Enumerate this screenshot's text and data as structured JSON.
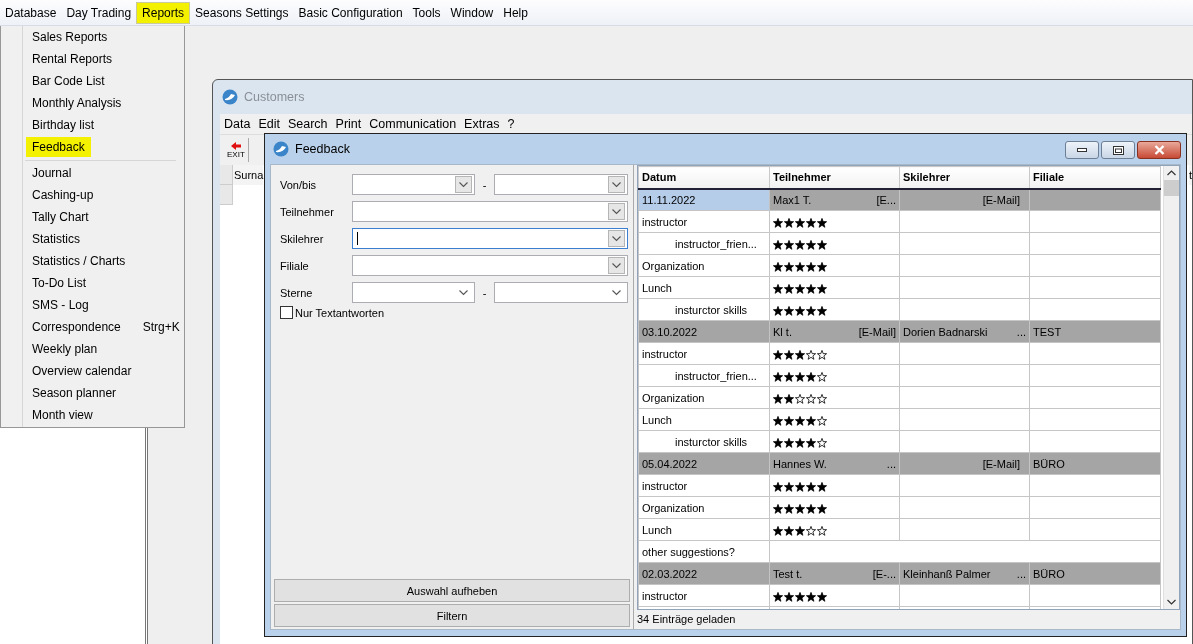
{
  "menubar": {
    "items": [
      {
        "label": "Database",
        "selected": false
      },
      {
        "label": "Day Trading",
        "selected": false
      },
      {
        "label": "Reports",
        "selected": true
      },
      {
        "label": "Seasons Settings",
        "selected": false
      },
      {
        "label": "Basic Configuration",
        "selected": false
      },
      {
        "label": "Tools",
        "selected": false
      },
      {
        "label": "Window",
        "selected": false
      },
      {
        "label": "Help",
        "selected": false
      }
    ]
  },
  "reports_menu": {
    "sections": [
      {
        "items": [
          {
            "label": "Sales Reports",
            "selected": false
          },
          {
            "label": "Rental Reports",
            "selected": false
          },
          {
            "label": "Bar Code List",
            "selected": false
          },
          {
            "label": "Monthly Analysis",
            "selected": false
          },
          {
            "label": "Birthday list",
            "selected": false
          },
          {
            "label": "Feedback",
            "selected": true
          }
        ]
      },
      {
        "items": [
          {
            "label": "Journal",
            "selected": false
          },
          {
            "label": "Cashing-up",
            "selected": false
          },
          {
            "label": "Tally Chart",
            "selected": false
          },
          {
            "label": "Statistics",
            "selected": false
          },
          {
            "label": "Statistics / Charts",
            "selected": false
          },
          {
            "label": "To-Do List",
            "selected": false
          },
          {
            "label": "SMS - Log",
            "selected": false
          },
          {
            "label": "Correspondence",
            "shortcut": "Strg+K",
            "selected": false
          },
          {
            "label": "Weekly plan",
            "selected": false
          },
          {
            "label": "Overview calendar",
            "selected": false
          },
          {
            "label": "Season planner",
            "selected": false
          },
          {
            "label": "Month view",
            "selected": false
          }
        ]
      }
    ]
  },
  "customers_window": {
    "title": "Customers",
    "menu": [
      "Data",
      "Edit",
      "Search",
      "Print",
      "Communication",
      "Extras",
      "?"
    ],
    "toolbar": {
      "exit_label": "EXIT"
    },
    "grid": {
      "columns": [
        "Surna",
        "t"
      ]
    }
  },
  "feedback_window": {
    "title": "Feedback",
    "filters": [
      {
        "label": "Von/bis",
        "kind": "date_range",
        "separator": "-",
        "focused": false
      },
      {
        "label": "Teilnehmer",
        "kind": "combo",
        "focused": false
      },
      {
        "label": "Skilehrer",
        "kind": "combo",
        "focused": true
      },
      {
        "label": "Filiale",
        "kind": "combo",
        "focused": false
      },
      {
        "label": "Sterne",
        "kind": "star_range",
        "separator": "-",
        "focused": false
      }
    ],
    "text_only": {
      "label": "Nur Textantworten",
      "checked": false
    },
    "buttons": [
      "Auswahl aufheben",
      "Filtern"
    ],
    "table": {
      "columns": [
        "Datum",
        "Teilnehmer",
        "Skilehrer",
        "Filiale"
      ],
      "rows": [
        {
          "kind": "group",
          "selected": true,
          "cells": [
            {
              "text": "11.11.2022"
            },
            {
              "text": "Max1 T.",
              "note": "[E..."
            },
            {
              "note": "[E-Mail]"
            },
            {}
          ]
        },
        {
          "kind": "rating",
          "question": "instructor",
          "stars": 5,
          "children": [
            {
              "kind": "rating",
              "question": "instructor_frien...",
              "stars": 5
            }
          ]
        },
        {
          "kind": "rating",
          "question": "Organization",
          "stars": 5
        },
        {
          "kind": "rating",
          "question": "Lunch",
          "stars": 5,
          "children": [
            {
              "kind": "rating",
              "question": "insturctor skills",
              "stars": 5
            }
          ]
        },
        {
          "kind": "group",
          "selected": false,
          "cells": [
            {
              "text": "03.10.2022"
            },
            {
              "text": "Kl t.",
              "note": "[E-Mail]"
            },
            {
              "text": "Dorien Badnarski",
              "note": "..."
            },
            {
              "text": "TEST"
            }
          ]
        },
        {
          "kind": "rating",
          "question": "instructor",
          "stars": 3,
          "children": [
            {
              "kind": "rating",
              "question": "instructor_frien...",
              "stars": 4
            }
          ]
        },
        {
          "kind": "rating",
          "question": "Organization",
          "stars": 2
        },
        {
          "kind": "rating",
          "question": "Lunch",
          "stars": 4,
          "children": [
            {
              "kind": "rating",
              "question": "insturctor skills",
              "stars": 4
            }
          ]
        },
        {
          "kind": "group",
          "selected": false,
          "cells": [
            {
              "text": "05.04.2022"
            },
            {
              "text": "Hannes W.",
              "note": "..."
            },
            {
              "note": "[E-Mail]"
            },
            {
              "text": "BÜRO"
            }
          ]
        },
        {
          "kind": "rating",
          "question": "instructor",
          "stars": 5
        },
        {
          "kind": "rating",
          "question": "Organization",
          "stars": 5
        },
        {
          "kind": "rating",
          "question": "Lunch",
          "stars": 3
        },
        {
          "kind": "text",
          "question": "other suggestions?"
        },
        {
          "kind": "group",
          "selected": false,
          "cells": [
            {
              "text": "02.03.2022"
            },
            {
              "text": "Test t.",
              "note": "[E-..."
            },
            {
              "text": "Kleinhanß Palmer",
              "note": "..."
            },
            {
              "text": "BÜRO"
            }
          ]
        },
        {
          "kind": "rating",
          "question": "instructor",
          "stars": 5
        }
      ]
    },
    "status_bar": "34 Einträge geladen"
  }
}
